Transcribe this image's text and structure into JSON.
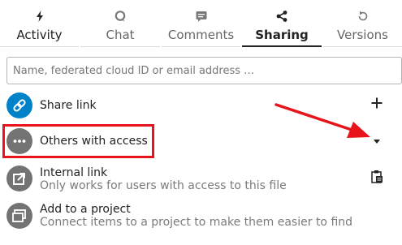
{
  "tabs": [
    {
      "label": "Activity",
      "icon": "lightning-icon",
      "active": false
    },
    {
      "label": "Chat",
      "icon": "chat-bubble-icon",
      "active": false
    },
    {
      "label": "Comments",
      "icon": "comment-icon",
      "active": false
    },
    {
      "label": "Sharing",
      "icon": "share-icon",
      "active": true
    },
    {
      "label": "Versions",
      "icon": "history-icon",
      "active": false
    }
  ],
  "search": {
    "placeholder": "Name, federated cloud ID or email address …"
  },
  "share_link": {
    "label": "Share link",
    "icon": "link-icon",
    "action_icon": "plus-icon"
  },
  "others_with_access": {
    "label": "Others with access",
    "icon": "more-horizontal-icon",
    "action_icon": "caret-down-icon"
  },
  "internal_link": {
    "title": "Internal link",
    "subtitle": "Only works for users with access to this file",
    "icon": "external-link-icon",
    "action_icon": "clipboard-icon"
  },
  "add_to_project": {
    "title": "Add to a project",
    "subtitle": "Connect items to a project to make them easier to find",
    "icon": "project-icon"
  },
  "colors": {
    "accent_blue": "#0082c9",
    "avatar_grey": "#737373",
    "annotation_red": "#e8141c",
    "active_tab": "#222222"
  }
}
